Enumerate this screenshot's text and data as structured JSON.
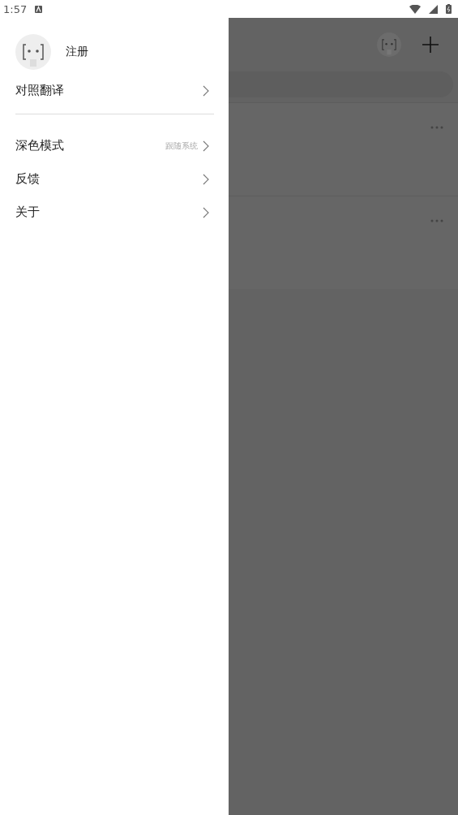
{
  "status_bar": {
    "time": "1:57"
  },
  "drawer": {
    "user": {
      "label": "注册"
    },
    "sections": [
      {
        "items": [
          {
            "label": "对照翻译"
          }
        ]
      },
      {
        "items": [
          {
            "label": "深色模式",
            "value": "跟随系统"
          },
          {
            "label": "反馈"
          },
          {
            "label": "关于"
          }
        ]
      }
    ]
  }
}
